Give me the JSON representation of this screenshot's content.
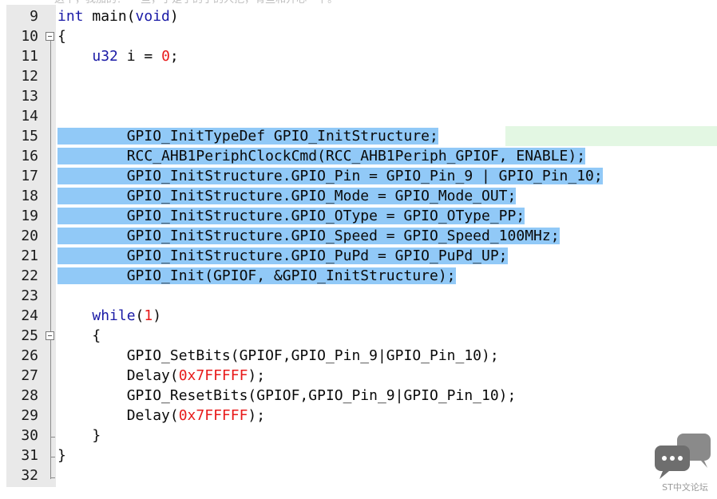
{
  "top_partial_text": "这个，我加的？ 一些，于是乎的了的人把，有些和开心一下。",
  "editor": {
    "lines": [
      {
        "num": "9",
        "parts": [
          {
            "t": "int",
            "c": "kw"
          },
          {
            "t": " main("
          },
          {
            "t": "void",
            "c": "kw"
          },
          {
            "t": ")"
          }
        ]
      },
      {
        "num": "10",
        "parts": [
          {
            "t": "{"
          }
        ]
      },
      {
        "num": "11",
        "parts": [
          {
            "t": "    "
          },
          {
            "t": "u32",
            "c": "kw"
          },
          {
            "t": " i = "
          },
          {
            "t": "0",
            "c": "num"
          },
          {
            "t": ";"
          }
        ]
      },
      {
        "num": "12",
        "parts": []
      },
      {
        "num": "13",
        "parts": []
      },
      {
        "num": "14",
        "parts": []
      },
      {
        "num": "15",
        "parts": [
          {
            "t": "        GPIO_InitTypeDef GPIO_InitStructure;",
            "sel": true
          }
        ]
      },
      {
        "num": "16",
        "parts": [
          {
            "t": "        RCC_AHB1PeriphClockCmd(RCC_AHB1Periph_GPIOF, ENABLE);",
            "sel": true
          }
        ]
      },
      {
        "num": "17",
        "parts": [
          {
            "t": "        GPIO_InitStructure.GPIO_Pin = GPIO_Pin_9 | GPIO_Pin_10;",
            "sel": true
          }
        ]
      },
      {
        "num": "18",
        "parts": [
          {
            "t": "        GPIO_InitStructure.GPIO_Mode = GPIO_Mode_OUT;",
            "sel": true
          }
        ]
      },
      {
        "num": "19",
        "parts": [
          {
            "t": "        GPIO_InitStructure.GPIO_OType = GPIO_OType_PP;",
            "sel": true
          }
        ]
      },
      {
        "num": "20",
        "parts": [
          {
            "t": "        GPIO_InitStructure.GPIO_Speed = GPIO_Speed_100MHz;",
            "sel": true
          }
        ]
      },
      {
        "num": "21",
        "parts": [
          {
            "t": "        GPIO_InitStructure.GPIO_PuPd = GPIO_PuPd_UP;",
            "sel": true
          }
        ]
      },
      {
        "num": "22",
        "parts": [
          {
            "t": "        GPIO_Init(GPIOF, &GPIO_InitStructure);",
            "sel": true
          }
        ]
      },
      {
        "num": "23",
        "parts": []
      },
      {
        "num": "24",
        "parts": [
          {
            "t": "    "
          },
          {
            "t": "while",
            "c": "kw"
          },
          {
            "t": "("
          },
          {
            "t": "1",
            "c": "num"
          },
          {
            "t": ")"
          }
        ]
      },
      {
        "num": "25",
        "parts": [
          {
            "t": "    {"
          }
        ]
      },
      {
        "num": "26",
        "parts": [
          {
            "t": "        GPIO_SetBits(GPIOF,GPIO_Pin_9|GPIO_Pin_10);"
          }
        ]
      },
      {
        "num": "27",
        "parts": [
          {
            "t": "        Delay("
          },
          {
            "t": "0x7FFFFF",
            "c": "num"
          },
          {
            "t": ");"
          }
        ]
      },
      {
        "num": "28",
        "parts": [
          {
            "t": "        GPIO_ResetBits(GPIOF,GPIO_Pin_9|GPIO_Pin_10);"
          }
        ]
      },
      {
        "num": "29",
        "parts": [
          {
            "t": "        Delay("
          },
          {
            "t": "0x7FFFFF",
            "c": "num"
          },
          {
            "t": ");"
          }
        ]
      },
      {
        "num": "30",
        "parts": [
          {
            "t": "    }"
          }
        ]
      },
      {
        "num": "31",
        "parts": [
          {
            "t": "}"
          }
        ]
      },
      {
        "num": "32",
        "parts": []
      }
    ]
  },
  "watermark": {
    "text": "ST中文论坛",
    "icon": "chat-bubbles-icon"
  },
  "colors": {
    "selection": "#91c9f7",
    "keyword": "#1a1aa6",
    "number": "#e81a1a",
    "gutter": "#e9e9e9",
    "current_line": "#e3f7e3"
  }
}
